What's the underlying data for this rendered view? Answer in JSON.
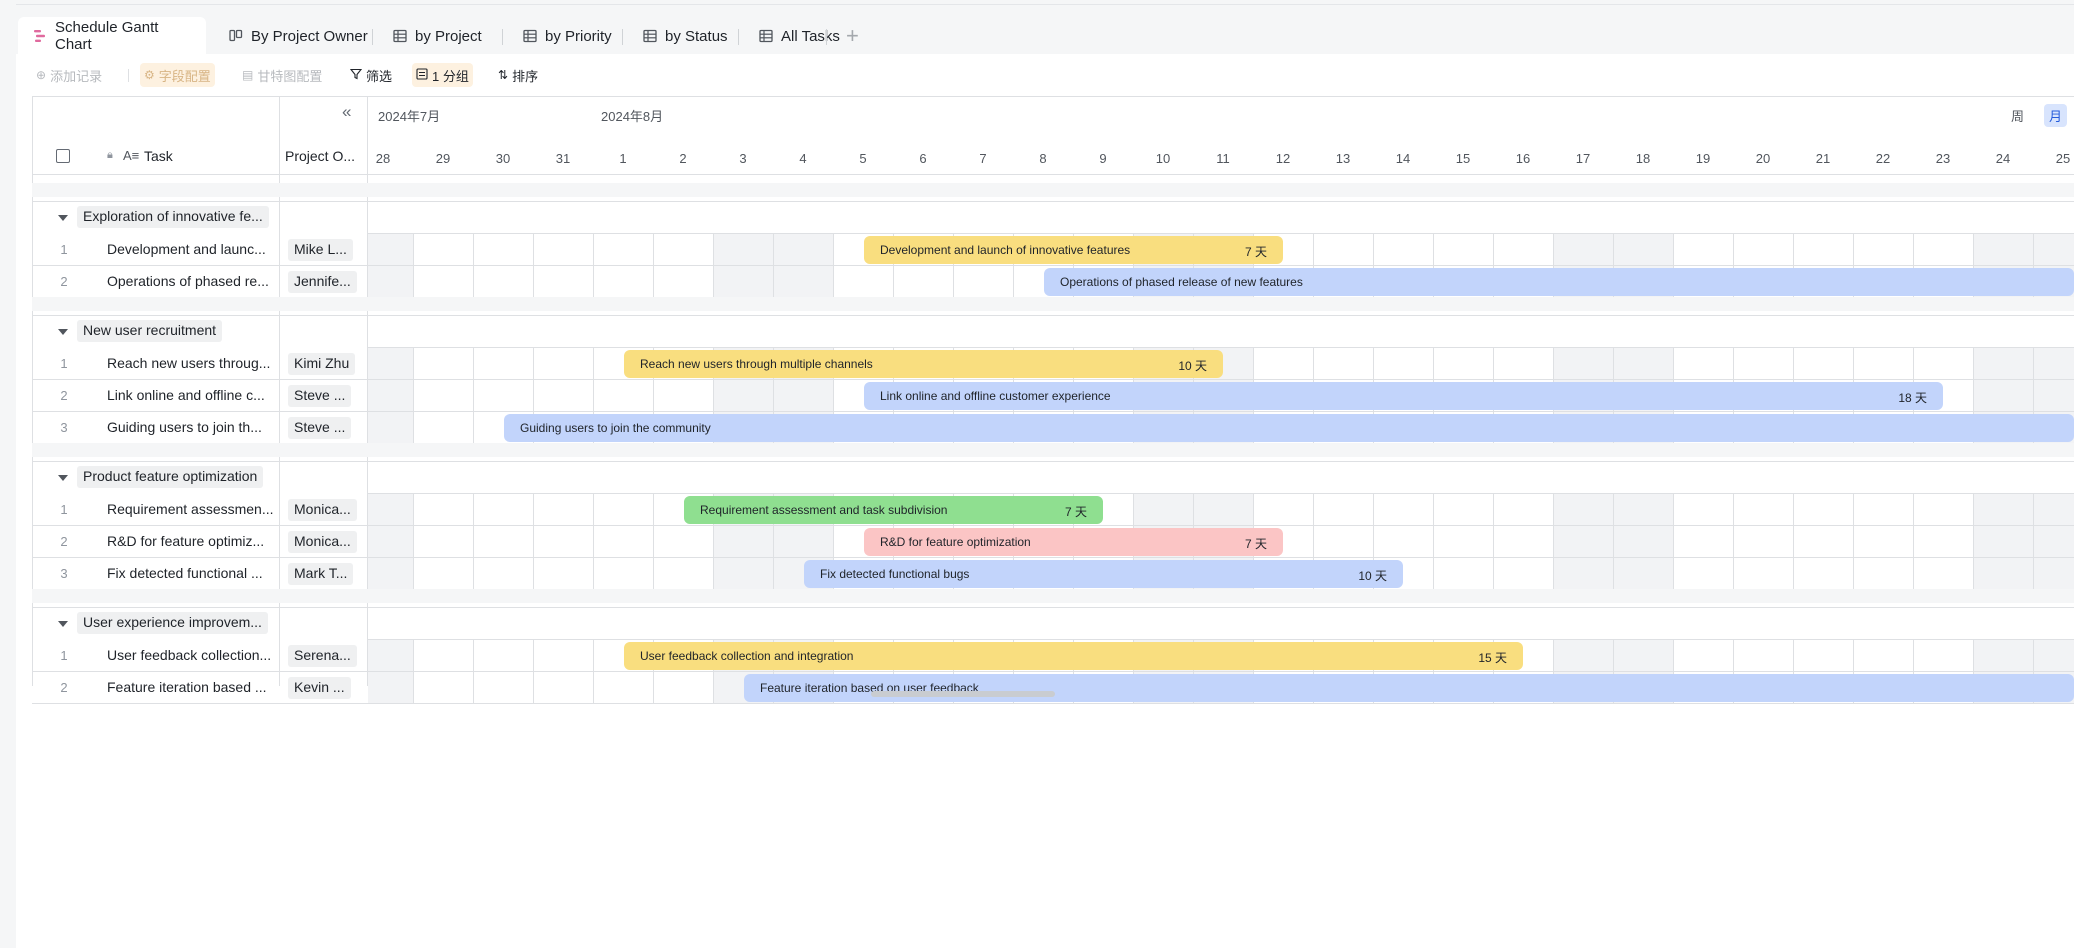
{
  "tabs": [
    {
      "label": "Schedule Gantt Chart",
      "icon": "gantt-icon",
      "active": true
    },
    {
      "label": "By Project Owner",
      "icon": "kanban-icon"
    },
    {
      "label": "by Project",
      "icon": "grid-icon"
    },
    {
      "label": "by Priority",
      "icon": "grid-icon"
    },
    {
      "label": "by Status",
      "icon": "grid-icon"
    },
    {
      "label": "All Tasks",
      "icon": "grid-icon"
    }
  ],
  "toolbar": {
    "add_record": "添加记录",
    "field_config": "字段配置",
    "gantt_config": "甘特图配置",
    "filter": "筛选",
    "group": "1 分组",
    "sort": "排序"
  },
  "columns": {
    "task": "Task",
    "owner": "Project O..."
  },
  "timeline": {
    "months": [
      "2024年7月",
      "2024年8月"
    ],
    "days": [
      "28",
      "29",
      "30",
      "31",
      "1",
      "2",
      "3",
      "4",
      "5",
      "6",
      "7",
      "8",
      "9",
      "10",
      "11",
      "12",
      "13",
      "14",
      "15",
      "16",
      "17",
      "18",
      "19",
      "20",
      "21",
      "22",
      "23",
      "24",
      "25"
    ],
    "view_week": "周",
    "view_month": "月"
  },
  "groups": [
    {
      "name": "Exploration of innovative fe...",
      "rows": [
        {
          "num": "1",
          "task": "Development and launc...",
          "owner": "Mike L...",
          "bar": "Development and launch of innovative features",
          "duration": "7 天",
          "color": "yellow"
        },
        {
          "num": "2",
          "task": "Operations of phased re...",
          "owner": "Jennife...",
          "bar": "Operations of phased release of new features",
          "duration": "",
          "color": "blue"
        }
      ]
    },
    {
      "name": "New user recruitment",
      "rows": [
        {
          "num": "1",
          "task": "Reach new users throug...",
          "owner": "Kimi Zhu",
          "bar": "Reach new users through multiple channels",
          "duration": "10 天",
          "color": "yellow"
        },
        {
          "num": "2",
          "task": "Link online and offline c...",
          "owner": "Steve ...",
          "bar": "Link online and offline customer experience",
          "duration": "18 天",
          "color": "blue"
        },
        {
          "num": "3",
          "task": "Guiding users to join th...",
          "owner": "Steve ...",
          "bar": "Guiding users to join the community",
          "duration": "",
          "color": "blue"
        }
      ]
    },
    {
      "name": "Product feature optimization",
      "rows": [
        {
          "num": "1",
          "task": "Requirement assessmen...",
          "owner": "Monica...",
          "bar": "Requirement assessment and task subdivision",
          "duration": "7 天",
          "color": "green"
        },
        {
          "num": "2",
          "task": "R&D for feature optimiz...",
          "owner": "Monica...",
          "bar": "R&D for feature optimization",
          "duration": "7 天",
          "color": "red"
        },
        {
          "num": "3",
          "task": "Fix detected functional ...",
          "owner": "Mark T...",
          "bar": "Fix detected functional bugs",
          "duration": "10 天",
          "color": "blue"
        }
      ]
    },
    {
      "name": "User experience improvem...",
      "rows": [
        {
          "num": "1",
          "task": "User feedback collection...",
          "owner": "Serena...",
          "bar": "User feedback collection and integration",
          "duration": "15 天",
          "color": "yellow"
        },
        {
          "num": "2",
          "task": "Feature iteration based ...",
          "owner": "Kevin ...",
          "bar": "Feature iteration based on user feedback",
          "duration": "",
          "color": "blue"
        }
      ]
    }
  ],
  "colors": {
    "yellow": "#f9de7f",
    "blue": "#c2d4fb",
    "green": "#8fdf90",
    "red": "#fbc5c5",
    "accent": "#245bdb"
  }
}
